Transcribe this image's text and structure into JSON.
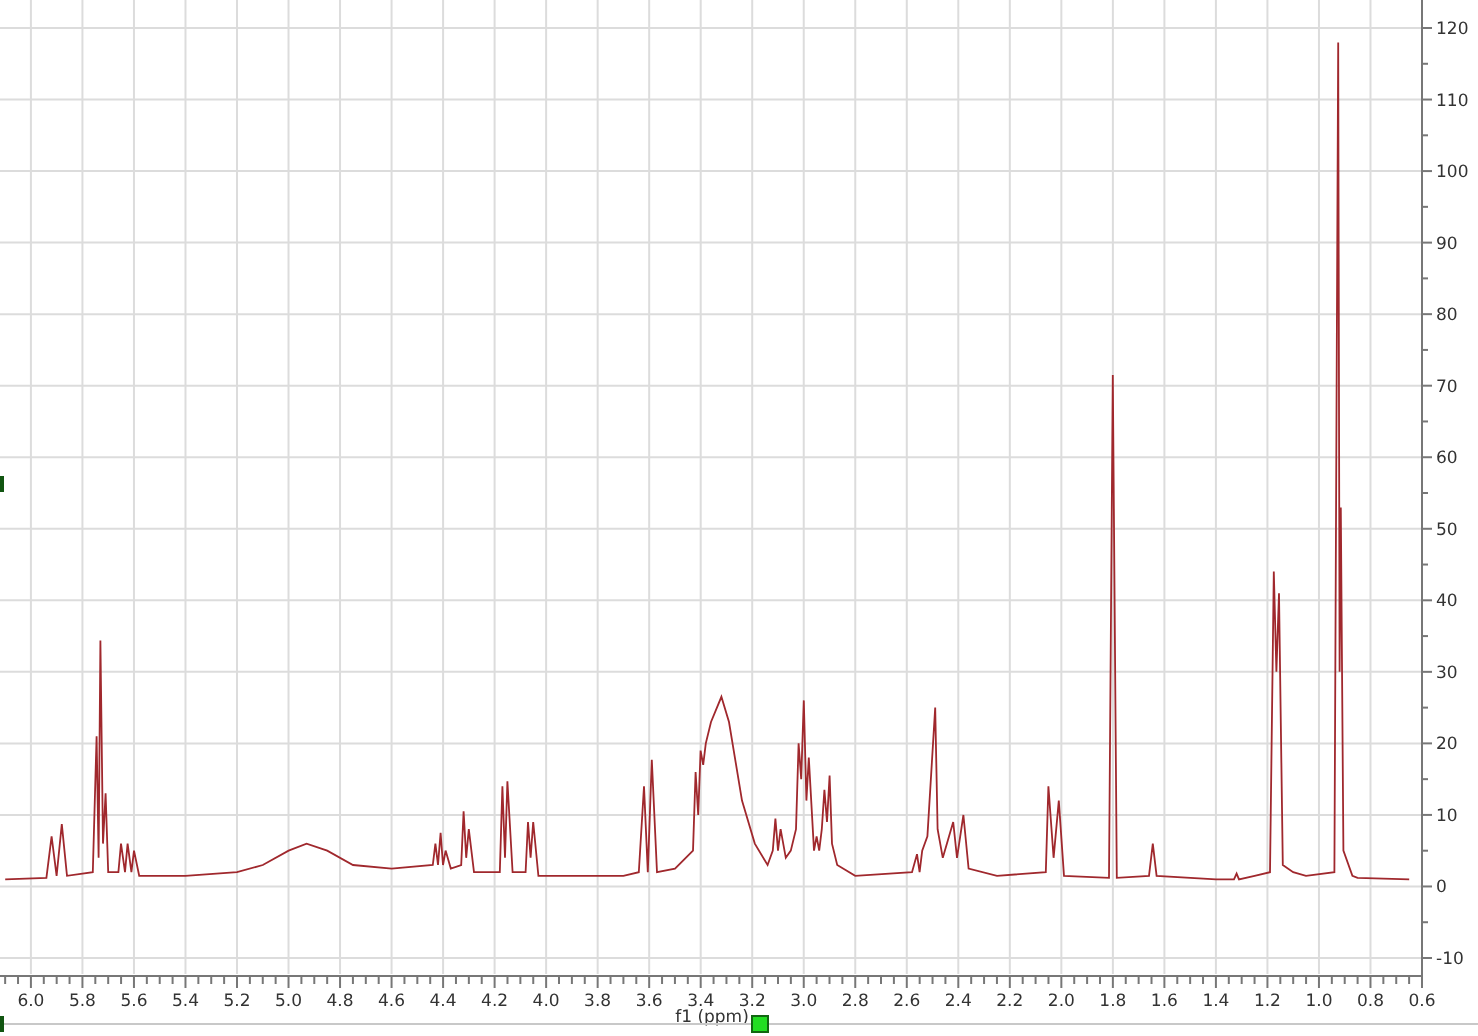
{
  "chart_data": {
    "type": "line",
    "xlabel": "f1 (ppm)",
    "grid": true,
    "xlim": [
      6.12,
      0.6
    ],
    "ylim": [
      -10,
      120
    ],
    "xticks": [
      {
        "value": 6,
        "label": "6.0"
      },
      5.8,
      5.6,
      5.4,
      5.2,
      {
        "value": 5,
        "label": "5.0"
      },
      4.8,
      4.6,
      4.4,
      4.2,
      {
        "value": 4,
        "label": "4.0"
      },
      3.8,
      3.6,
      3.4,
      3.2,
      {
        "value": 3,
        "label": "3.0"
      },
      2.8,
      2.6,
      2.4,
      2.2,
      {
        "value": 2,
        "label": "2.0"
      },
      1.8,
      1.6,
      1.4,
      1.2,
      {
        "value": 1,
        "label": "1.0"
      },
      0.8,
      0.6
    ],
    "yticks": [
      -10,
      0,
      10,
      20,
      30,
      40,
      50,
      60,
      70,
      80,
      90,
      100,
      110,
      120
    ],
    "x": [
      6.1,
      5.94,
      5.92,
      5.9,
      5.88,
      5.86,
      5.76,
      5.745,
      5.737,
      5.73,
      5.72,
      5.71,
      5.7,
      5.66,
      5.65,
      5.635,
      5.625,
      5.61,
      5.6,
      5.58,
      5.4,
      5.2,
      5.1,
      5.0,
      4.93,
      4.85,
      4.75,
      4.6,
      4.44,
      4.43,
      4.42,
      4.41,
      4.4,
      4.39,
      4.37,
      4.33,
      4.32,
      4.31,
      4.3,
      4.28,
      4.18,
      4.17,
      4.16,
      4.15,
      4.13,
      4.08,
      4.07,
      4.06,
      4.05,
      4.03,
      3.7,
      3.64,
      3.62,
      3.605,
      3.59,
      3.57,
      3.5,
      3.43,
      3.42,
      3.41,
      3.4,
      3.39,
      3.38,
      3.36,
      3.32,
      3.29,
      3.24,
      3.19,
      3.14,
      3.12,
      3.11,
      3.1,
      3.09,
      3.07,
      3.05,
      3.03,
      3.02,
      3.01,
      3.0,
      2.99,
      2.98,
      2.96,
      2.95,
      2.94,
      2.93,
      2.92,
      2.91,
      2.9,
      2.89,
      2.87,
      2.8,
      2.58,
      2.56,
      2.55,
      2.54,
      2.52,
      2.49,
      2.48,
      2.46,
      2.42,
      2.405,
      2.38,
      2.36,
      2.25,
      2.06,
      2.05,
      2.03,
      2.01,
      1.99,
      1.815,
      1.8,
      1.785,
      1.66,
      1.645,
      1.63,
      1.4,
      1.33,
      1.32,
      1.31,
      1.25,
      1.19,
      1.175,
      1.165,
      1.155,
      1.14,
      1.1,
      1.05,
      0.94,
      0.925,
      0.92,
      0.915,
      0.905,
      0.87,
      0.85,
      0.65
    ],
    "series": [
      {
        "color": "#a0282d",
        "values": [
          1,
          1.2,
          7,
          1.5,
          8.7,
          1.5,
          2,
          21,
          4,
          34.4,
          6,
          13,
          2,
          2,
          6,
          2,
          6,
          2,
          5,
          1.5,
          1.5,
          2,
          3,
          5,
          6,
          5,
          3,
          2.5,
          3,
          6,
          3,
          7.5,
          3,
          5,
          2.5,
          3,
          10.5,
          4,
          8,
          2,
          2,
          14,
          4,
          14.7,
          2,
          2,
          9,
          4,
          9,
          1.5,
          1.5,
          2,
          14,
          2,
          17.7,
          2,
          2.5,
          5,
          16,
          10,
          19,
          17,
          20,
          23,
          26.5,
          23,
          12,
          6,
          3,
          5,
          9.5,
          5,
          8,
          4,
          5,
          8,
          20,
          15,
          26,
          12,
          18,
          5,
          7,
          5,
          8,
          13.5,
          9,
          15.5,
          6,
          3,
          1.5,
          2,
          4.5,
          2,
          5,
          7,
          25,
          8,
          4,
          9,
          4,
          10,
          2.5,
          1.5,
          2,
          14,
          4,
          12,
          1.5,
          1.2,
          71.5,
          1.2,
          1.5,
          6,
          1.5,
          1,
          1,
          1.8,
          1,
          1.5,
          2,
          44,
          30,
          41,
          3,
          2,
          1.5,
          2,
          118,
          30,
          53,
          5,
          1.5,
          1.2,
          1
        ]
      }
    ]
  }
}
